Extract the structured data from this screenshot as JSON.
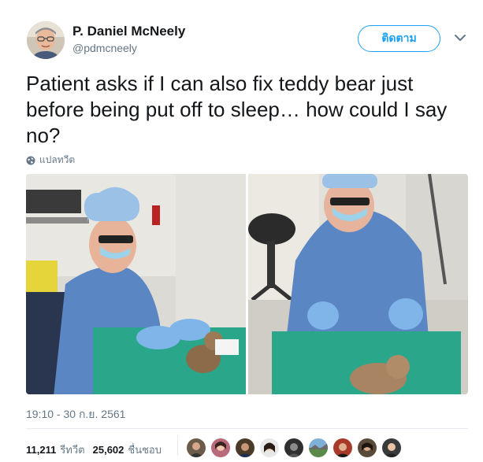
{
  "author": {
    "display_name": "P. Daniel McNeely",
    "handle": "@pdmcneely",
    "avatar_icon": "avatar-man-glasses"
  },
  "follow_button": {
    "label": "ติดตาม"
  },
  "menu": {
    "icon": "chevron-down-icon"
  },
  "tweet": {
    "text": "Patient asks if I can also fix teddy bear just before being put off to sleep… how could I say no?",
    "translate_label": "แปลทวีต",
    "timestamp": "19:10 - 30 ก.ย. 2561"
  },
  "media": {
    "photos": [
      {
        "icon": "photo-surgeon-with-teddy-bear-left"
      },
      {
        "icon": "photo-surgeon-with-teddy-bear-right"
      }
    ]
  },
  "stats": {
    "retweets": {
      "count": "11,211",
      "label": "รีทวีต"
    },
    "likes": {
      "count": "25,602",
      "label": "ชื่นชอบ"
    }
  },
  "likers_count_shown": 9,
  "colors": {
    "accent": "#1da1f2",
    "text": "#14171a",
    "secondary": "#657786",
    "divider": "#e6ecf0"
  }
}
